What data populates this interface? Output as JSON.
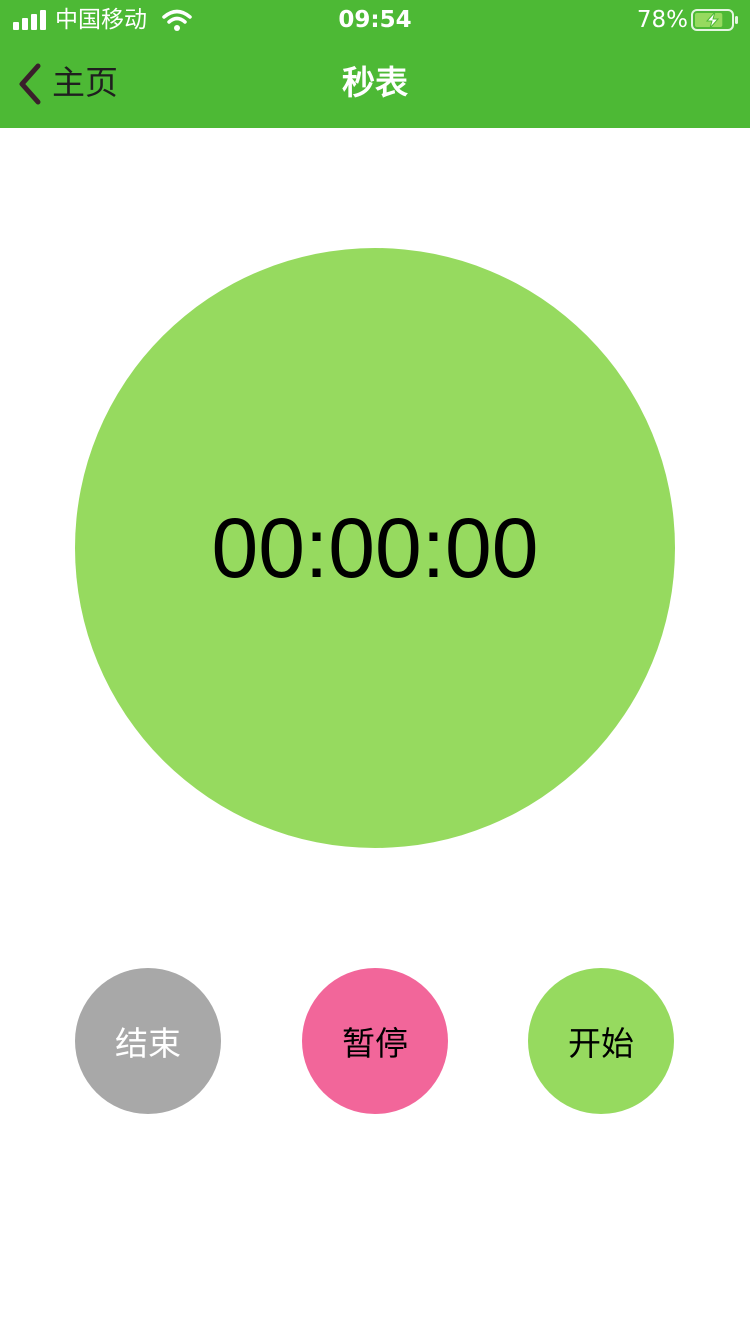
{
  "status_bar": {
    "carrier": "中国移动",
    "time": "09:54",
    "battery_percent": "78%",
    "battery_level": 0.78,
    "icons": [
      "signal-icon",
      "wifi-icon",
      "battery-charging-icon"
    ]
  },
  "nav": {
    "back_label": "主页",
    "back_icon": "chevron-left-icon",
    "title": "秒表"
  },
  "stopwatch": {
    "elapsed": "00:00:00"
  },
  "controls": {
    "end_label": "结束",
    "pause_label": "暂停",
    "start_label": "开始"
  },
  "colors": {
    "nav_bar": "#4db935",
    "dial": "#96da5f",
    "end_button": "#a8a8a8",
    "pause_button": "#f2669a",
    "start_button": "#96da5f"
  }
}
